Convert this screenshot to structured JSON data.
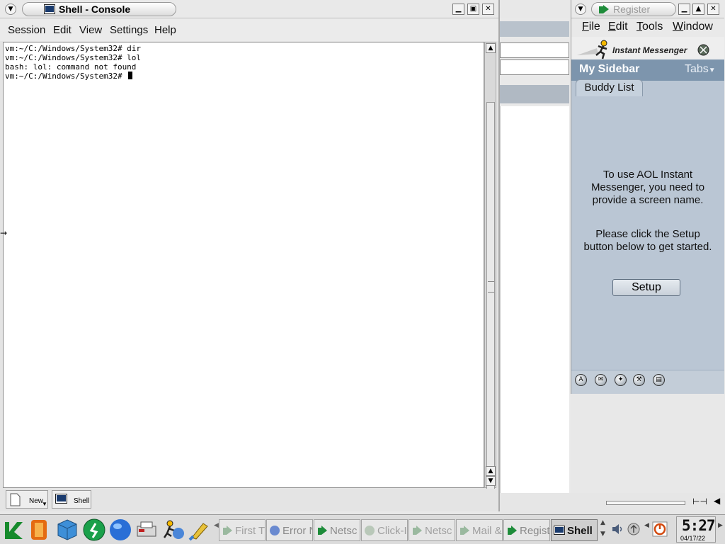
{
  "console": {
    "title": "Shell - Console",
    "menu": [
      "Session",
      "Edit",
      "View",
      "Settings",
      "Help"
    ],
    "terminal_lines": [
      "vm:~/C:/Windows/System32# dir",
      "vm:~/C:/Windows/System32# lol",
      "bash: lol: command not found",
      "vm:~/C:/Windows/System32# "
    ],
    "tabs": [
      {
        "label": "New",
        "icon": "new-document-icon"
      },
      {
        "label": "Shell",
        "icon": "terminal-icon"
      }
    ]
  },
  "aim": {
    "title": "Register",
    "menu": [
      "File",
      "Edit",
      "Tools",
      "Window"
    ],
    "brand": "Instant Messenger",
    "sidebar_title": "My Sidebar",
    "tabs_label": "Tabs",
    "buddy_tab": "Buddy List",
    "message1": [
      "To use AOL Instant",
      "Messenger, you need to",
      "provide a screen name."
    ],
    "message2": [
      "Please click the Setup",
      "button below to get started."
    ],
    "setup_label": "Setup",
    "footer_icons": [
      "aim-icon",
      "mail-icon",
      "compass-icon",
      "wrench-icon",
      "chat-icon"
    ]
  },
  "taskbar": {
    "launchers": [
      "kde-menu-icon",
      "lifebuoy-icon",
      "cube-icon",
      "aim-runner-icon",
      "globe-icon",
      "printer-icon",
      "aim-buddy-icon",
      "paintbrush-icon"
    ],
    "tasks": [
      {
        "label": "First T",
        "active": false
      },
      {
        "label": "Error N",
        "active": false
      },
      {
        "label": "Netsc",
        "active": false
      },
      {
        "label": "Click-I",
        "active": false
      },
      {
        "label": "Netsc",
        "active": false
      },
      {
        "label": "Mail &",
        "active": false
      },
      {
        "label": "Regist",
        "active": false
      },
      {
        "label": "Shell",
        "active": true
      }
    ],
    "clock_time": "5:27",
    "clock_date": "04/17/22"
  },
  "colors": {
    "aim_header": "#7d95ad",
    "aim_panel": "#bac6d4"
  }
}
